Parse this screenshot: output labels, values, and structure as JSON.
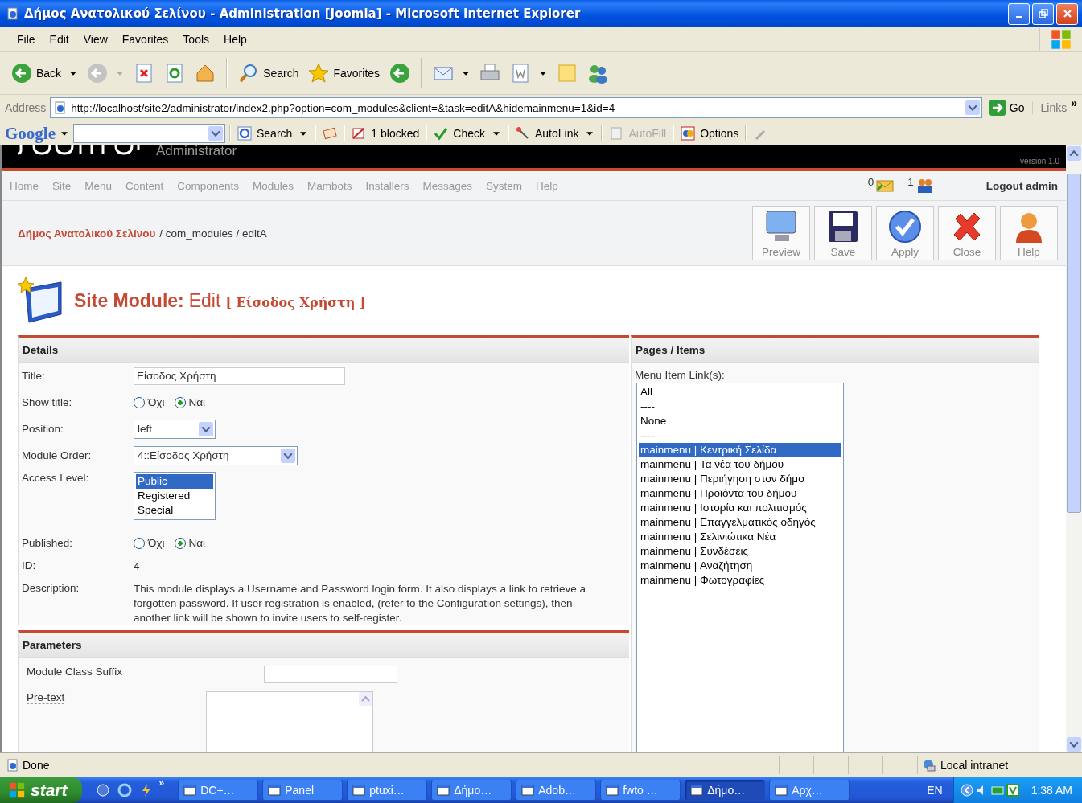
{
  "window": {
    "title": "Δήμος Ανατολικού Σελίνου - Administration [Joomla] - Microsoft Internet Explorer"
  },
  "menu_bar": [
    "File",
    "Edit",
    "View",
    "Favorites",
    "Tools",
    "Help"
  ],
  "toolbar": [
    {
      "items": [
        {
          "kind": "back",
          "label": "Back",
          "dropdown": true
        },
        {
          "kind": "forward",
          "dropdown": true
        },
        {
          "kind": "stop"
        },
        {
          "kind": "refresh"
        },
        {
          "kind": "home"
        }
      ]
    },
    {
      "items": [
        {
          "kind": "search",
          "label": "Search"
        },
        {
          "kind": "favorites",
          "label": "Favorites"
        },
        {
          "kind": "history"
        }
      ]
    },
    {
      "items": [
        {
          "kind": "mail",
          "dropdown": true
        },
        {
          "kind": "print"
        },
        {
          "kind": "edit",
          "dropdown": true
        },
        {
          "kind": "note"
        },
        {
          "kind": "messenger"
        }
      ]
    }
  ],
  "address_bar": {
    "label": "Address",
    "url": "http://localhost/site2/administrator/index2.php?option=com_modules&client=&task=editA&hidemainmenu=1&id=4",
    "go": "Go",
    "links": "Links",
    "more": "»"
  },
  "google_toolbar": {
    "logo": "Google",
    "items": [
      {
        "kind": "search",
        "label": "Search",
        "dropdown": true
      },
      {
        "kind": "news"
      },
      {
        "kind": "popup",
        "label": "1 blocked"
      },
      {
        "kind": "check",
        "label": "Check",
        "dropdown": true
      },
      {
        "kind": "autolink",
        "label": "AutoLink",
        "dropdown": true
      },
      {
        "kind": "autofill",
        "label": "AutoFill",
        "disabled": true
      },
      {
        "kind": "options",
        "label": "Options"
      },
      {
        "kind": "pencil"
      }
    ]
  },
  "joomla": {
    "subtitle": "Administrator",
    "version": "version 1.0",
    "nav": [
      "Home",
      "Site",
      "Menu",
      "Content",
      "Components",
      "Modules",
      "Mambots",
      "Installers",
      "Messages",
      "System",
      "Help"
    ],
    "messages_count": "0",
    "users_count": "1",
    "logout": "Logout admin",
    "breadcrumb": {
      "site": "Δήμος Ανατολικού Σελίνου",
      "path": "/ com_modules / editA"
    },
    "actions": [
      {
        "kind": "preview",
        "label": "Preview"
      },
      {
        "kind": "save",
        "label": "Save"
      },
      {
        "kind": "apply",
        "label": "Apply"
      },
      {
        "kind": "close",
        "label": "Close"
      },
      {
        "kind": "help",
        "label": "Help"
      }
    ]
  },
  "heading": {
    "title": "Site Module:",
    "action": "Edit",
    "name": "[ Είσοδος Χρήστη ]"
  },
  "details": {
    "header": "Details",
    "fields": [
      {
        "label": "Title:",
        "kind": "text",
        "value": "Είσοδος Χρήστη"
      },
      {
        "label": "Show title:",
        "kind": "radio",
        "options": [
          {
            "label": "Όχι",
            "selected": false
          },
          {
            "label": "Ναι",
            "selected": true
          }
        ]
      },
      {
        "label": "Position:",
        "kind": "select",
        "value": "left"
      },
      {
        "label": "Module Order:",
        "kind": "select",
        "value": "4::Είσοδος Χρήστη"
      },
      {
        "label": "Access Level:",
        "kind": "listbox",
        "options": [
          {
            "label": "Public",
            "selected": true
          },
          {
            "label": "Registered",
            "selected": false
          },
          {
            "label": "Special",
            "selected": false
          }
        ]
      },
      {
        "label": "Published:",
        "kind": "radio",
        "options": [
          {
            "label": "Όχι",
            "selected": false
          },
          {
            "label": "Ναι",
            "selected": true
          }
        ]
      },
      {
        "label": "ID:",
        "kind": "static",
        "value": "4"
      },
      {
        "label": "Description:",
        "kind": "static",
        "value": "This module displays a Username and Password login form. It also displays a link to retrieve a forgotten password. If user registration is enabled, (refer to the Configuration settings), then another link will be shown to invite users to self-register."
      }
    ]
  },
  "parameters": {
    "header": "Parameters",
    "fields": [
      {
        "label": "Module Class Suffix",
        "kind": "text"
      },
      {
        "label": "Pre-text",
        "kind": "textarea"
      }
    ]
  },
  "pages": {
    "header": "Pages / Items",
    "label": "Menu Item Link(s):",
    "options": [
      {
        "label": "All",
        "selected": false
      },
      {
        "label": "----",
        "selected": false
      },
      {
        "label": "None",
        "selected": false
      },
      {
        "label": "----",
        "selected": false
      },
      {
        "label": "mainmenu | Κεντρική Σελίδα",
        "selected": true
      },
      {
        "label": "mainmenu | Τα νέα του δήμου",
        "selected": false
      },
      {
        "label": "mainmenu | Περιήγηση στον δήμο",
        "selected": false
      },
      {
        "label": "mainmenu | Προϊόντα του δήμου",
        "selected": false
      },
      {
        "label": "mainmenu | Ιστορία και πολιτισμός",
        "selected": false
      },
      {
        "label": "mainmenu | Επαγγελματικός οδηγός",
        "selected": false
      },
      {
        "label": "mainmenu | Σελινιώτικα Νέα",
        "selected": false
      },
      {
        "label": "mainmenu | Συνδέσεις",
        "selected": false
      },
      {
        "label": "mainmenu | Αναζήτηση",
        "selected": false
      },
      {
        "label": "mainmenu | Φωτογραφίες",
        "selected": false
      }
    ]
  },
  "status_bar": {
    "text": "Done",
    "zone": "Local intranet"
  },
  "taskbar": {
    "start": "start",
    "more": "»",
    "tasks": [
      {
        "label": "DC+…",
        "selected": false
      },
      {
        "label": "Panel",
        "selected": false
      },
      {
        "label": "ptuxi…",
        "selected": false
      },
      {
        "label": "Δήμο…",
        "selected": false
      },
      {
        "label": "Adob…",
        "selected": false
      },
      {
        "label": "fwto …",
        "selected": false
      },
      {
        "label": "Δήμο…",
        "selected": true
      },
      {
        "label": "Αρχ…",
        "selected": false
      }
    ],
    "language": "EN",
    "time": "1:38 AM"
  }
}
